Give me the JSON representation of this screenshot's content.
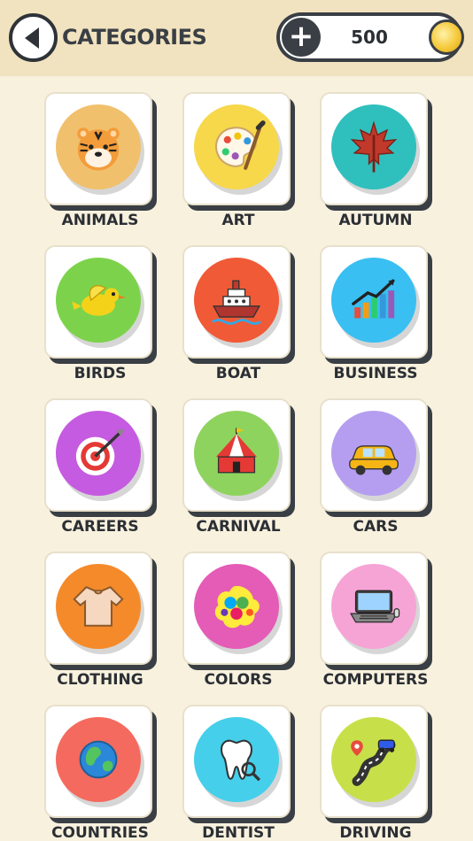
{
  "header": {
    "title": "CATEGORIES",
    "coins": "500"
  },
  "categories": [
    {
      "label": "ANIMALS",
      "icon": "tiger-icon",
      "color": "#f1c06c"
    },
    {
      "label": "ART",
      "icon": "paint-palette-icon",
      "color": "#f6d84a"
    },
    {
      "label": "AUTUMN",
      "icon": "maple-leaf-icon",
      "color": "#2fc0bd"
    },
    {
      "label": "BIRDS",
      "icon": "bird-icon",
      "color": "#7cd34b"
    },
    {
      "label": "BOAT",
      "icon": "ship-icon",
      "color": "#f05a36"
    },
    {
      "label": "BUSINESS",
      "icon": "growth-chart-icon",
      "color": "#39bff2"
    },
    {
      "label": "CAREERS",
      "icon": "target-icon",
      "color": "#c55be0"
    },
    {
      "label": "CARNIVAL",
      "icon": "circus-tent-icon",
      "color": "#8fd35f"
    },
    {
      "label": "CARS",
      "icon": "car-icon",
      "color": "#b59ef0"
    },
    {
      "label": "CLOTHING",
      "icon": "sweater-icon",
      "color": "#f58a2a"
    },
    {
      "label": "COLORS",
      "icon": "paint-splash-icon",
      "color": "#e45cb5"
    },
    {
      "label": "COMPUTERS",
      "icon": "laptop-icon",
      "color": "#f6a4d6"
    },
    {
      "label": "COUNTRIES",
      "icon": "globe-icon",
      "color": "#f56a5e"
    },
    {
      "label": "DENTIST",
      "icon": "tooth-icon",
      "color": "#45cfea"
    },
    {
      "label": "DRIVING",
      "icon": "road-map-icon",
      "color": "#c7e04a"
    }
  ]
}
